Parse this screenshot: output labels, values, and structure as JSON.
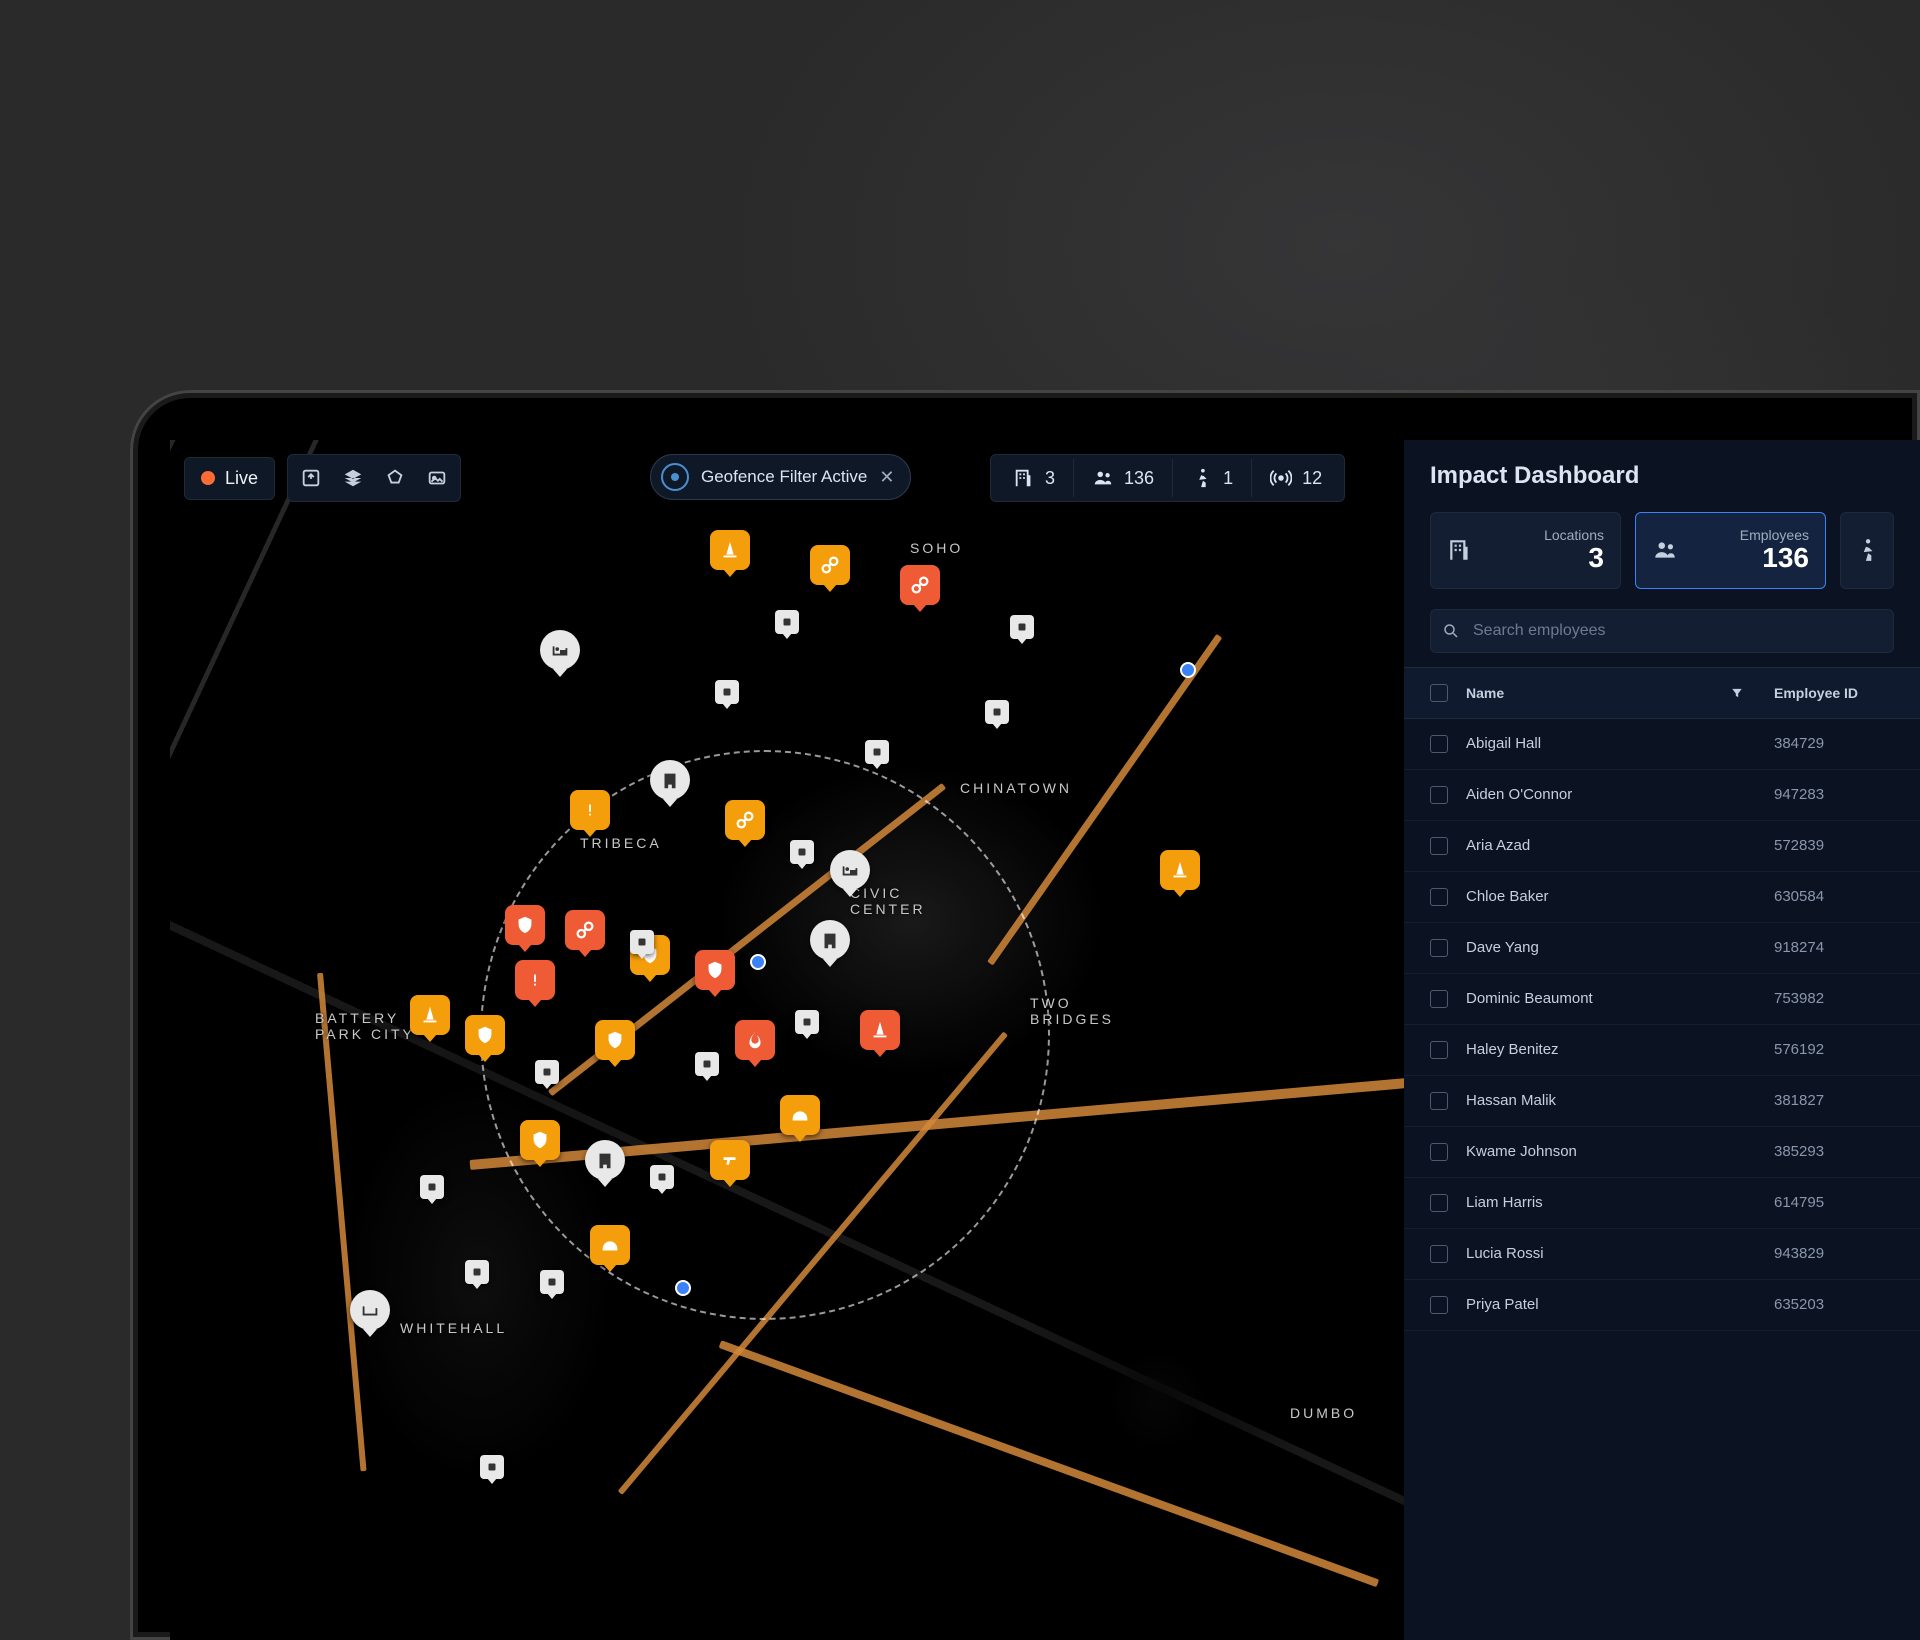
{
  "topbar": {
    "live_label": "Live",
    "geofence_label": "Geofence Filter Active",
    "stats": {
      "locations": "3",
      "employees": "136",
      "travelers": "1",
      "signals": "12"
    }
  },
  "map_labels": {
    "tribeca": "TRIBECA",
    "chinatown": "CHINATOWN",
    "soho": "SOHO",
    "battery": "BATTERY\nPARK CITY",
    "two_bridges": "TWO\nBRIDGES",
    "civic": "CIVIC\nCENTER",
    "whitehall": "WHITEHALL",
    "dumbo": "DUMBO"
  },
  "sidebar": {
    "title": "Impact Dashboard",
    "cards": {
      "locations_label": "Locations",
      "locations_count": "3",
      "employees_label": "Employees",
      "employees_count": "136"
    },
    "search_placeholder": "Search employees",
    "columns": {
      "name": "Name",
      "id": "Employee ID"
    },
    "employees": [
      {
        "name": "Abigail Hall",
        "id": "384729"
      },
      {
        "name": "Aiden O'Connor",
        "id": "947283"
      },
      {
        "name": "Aria Azad",
        "id": "572839"
      },
      {
        "name": "Chloe Baker",
        "id": "630584"
      },
      {
        "name": "Dave Yang",
        "id": "918274"
      },
      {
        "name": "Dominic Beaumont",
        "id": "753982"
      },
      {
        "name": "Haley Benitez",
        "id": "576192"
      },
      {
        "name": "Hassan Malik",
        "id": "381827"
      },
      {
        "name": "Kwame Johnson",
        "id": "385293"
      },
      {
        "name": "Liam Harris",
        "id": "614795"
      },
      {
        "name": "Lucia Rossi",
        "id": "943829"
      },
      {
        "name": "Priya Patel",
        "id": "635203"
      }
    ]
  },
  "colors": {
    "accent_blue": "#3b82f6",
    "accent_orange": "#f59e0b",
    "accent_red": "#ef5b34",
    "live_dot": "#ff6b35"
  }
}
